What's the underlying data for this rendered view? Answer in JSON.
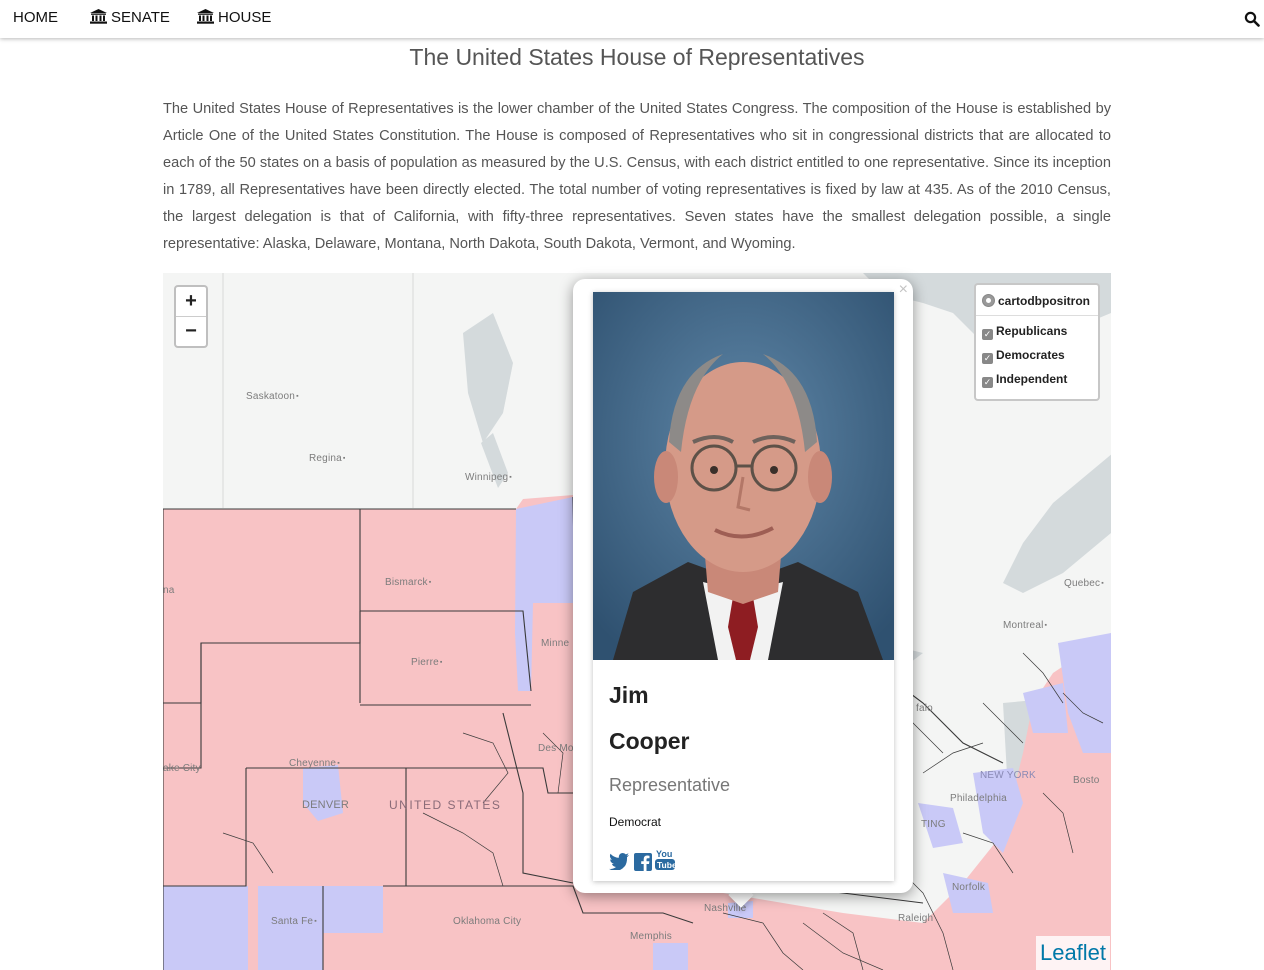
{
  "nav": {
    "home": "HOME",
    "senate": "SENATE",
    "house": "HOUSE",
    "icons": {
      "senate": "bank-icon",
      "house": "bank-icon",
      "search": "search-icon"
    }
  },
  "page": {
    "title": "The United States House of Representatives",
    "intro": "The United States House of Representatives is the lower chamber of the United States Congress. The composition of the House is established by Article One of the United States Constitution. The House is composed of Representatives who sit in congressional districts that are allocated to each of the 50 states on a basis of population as measured by the U.S. Census, with each district entitled to one representative. Since its inception in 1789, all Representatives have been directly elected. The total number of voting representatives is fixed by law at 435. As of the 2010 Census, the largest delegation is that of California, with fifty-three representatives. Seven states have the smallest delegation possible, a single representative: Alaska, Delaware, Montana, North Dakota, South Dakota, Vermont, and Wyoming."
  },
  "map": {
    "zoom_in": "+",
    "zoom_out": "−",
    "country_label": "UNITED STATES",
    "cities": {
      "saskatoon": "Saskatoon",
      "regina": "Regina",
      "winnipeg": "Winnipeg",
      "bismarck": "Bismarck",
      "pierre": "Pierre",
      "cheyenne": "Cheyenne",
      "denver": "DENVER",
      "santa_fe": "Santa Fe",
      "oklahoma_city": "Oklahoma City",
      "memphis": "Memphis",
      "nashville": "Nashville",
      "raleigh": "Raleigh",
      "norfolk": "Norfolk",
      "philadelphia": "Philadelphia",
      "new_york": "NEW YORK",
      "boston": "Bosto",
      "montreal": "Montreal",
      "quebec": "Quebec",
      "buffalo": "falo",
      "des_moines": "Des Mo",
      "minneapolis": "Minne",
      "helena": "na",
      "salt_lake": "ake City",
      "washington": "TING"
    },
    "layers": {
      "base": "cartodbpositron",
      "overlays": [
        "Republicans",
        "Democrates",
        "Independent"
      ]
    },
    "attribution": "Leaflet",
    "colors": {
      "republican": "#f8c3c5",
      "democrat": "#c9c9f7",
      "water": "#d4dadc",
      "land": "#f4f5f4"
    }
  },
  "popup": {
    "close": "×",
    "first_name": "Jim",
    "last_name": "Cooper",
    "role": "Representative",
    "party": "Democrat",
    "social": [
      "twitter-icon",
      "facebook-icon",
      "youtube-icon"
    ]
  }
}
